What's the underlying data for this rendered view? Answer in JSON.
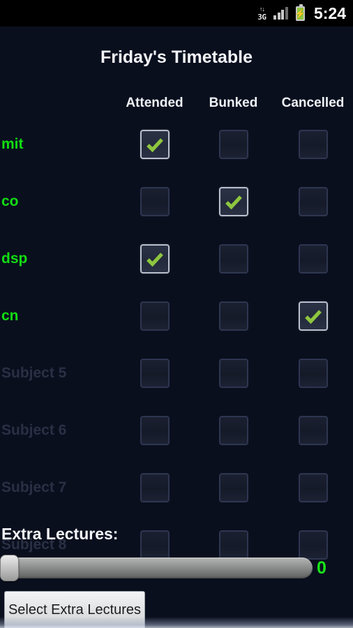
{
  "statusbar": {
    "network_arrows": "↑↓",
    "network_label": "3G",
    "signal_icon": "signal-bars-icon",
    "battery_icon": "battery-charging-icon",
    "battery_bolt": "⚡",
    "time": "5:24"
  },
  "header": {
    "title": "Friday's Timetable"
  },
  "table": {
    "columns": [
      "Attended",
      "Bunked",
      "Cancelled"
    ],
    "rows": [
      {
        "label": "mit",
        "enabled": true,
        "attended": true,
        "bunked": false,
        "cancelled": false
      },
      {
        "label": "co",
        "enabled": true,
        "attended": false,
        "bunked": true,
        "cancelled": false
      },
      {
        "label": "dsp",
        "enabled": true,
        "attended": true,
        "bunked": false,
        "cancelled": false
      },
      {
        "label": "cn",
        "enabled": true,
        "attended": false,
        "bunked": false,
        "cancelled": true
      },
      {
        "label": "Subject 5",
        "enabled": false,
        "attended": false,
        "bunked": false,
        "cancelled": false
      },
      {
        "label": "Subject 6",
        "enabled": false,
        "attended": false,
        "bunked": false,
        "cancelled": false
      },
      {
        "label": "Subject 7",
        "enabled": false,
        "attended": false,
        "bunked": false,
        "cancelled": false
      },
      {
        "label": "Subject 8",
        "enabled": false,
        "attended": false,
        "bunked": false,
        "cancelled": false
      }
    ]
  },
  "extra": {
    "label": "Extra Lectures:",
    "slider_value": "0",
    "slider_min": 0,
    "slider_max": 10,
    "button_label": "Select Extra Lectures"
  },
  "colors": {
    "background": "#0a0f1e",
    "accent_green": "#12dd12",
    "check_green": "#8ec63f",
    "title_text": "#f2f4f8",
    "disabled_text": "#2a3044",
    "statusbar_bg": "#000000"
  }
}
